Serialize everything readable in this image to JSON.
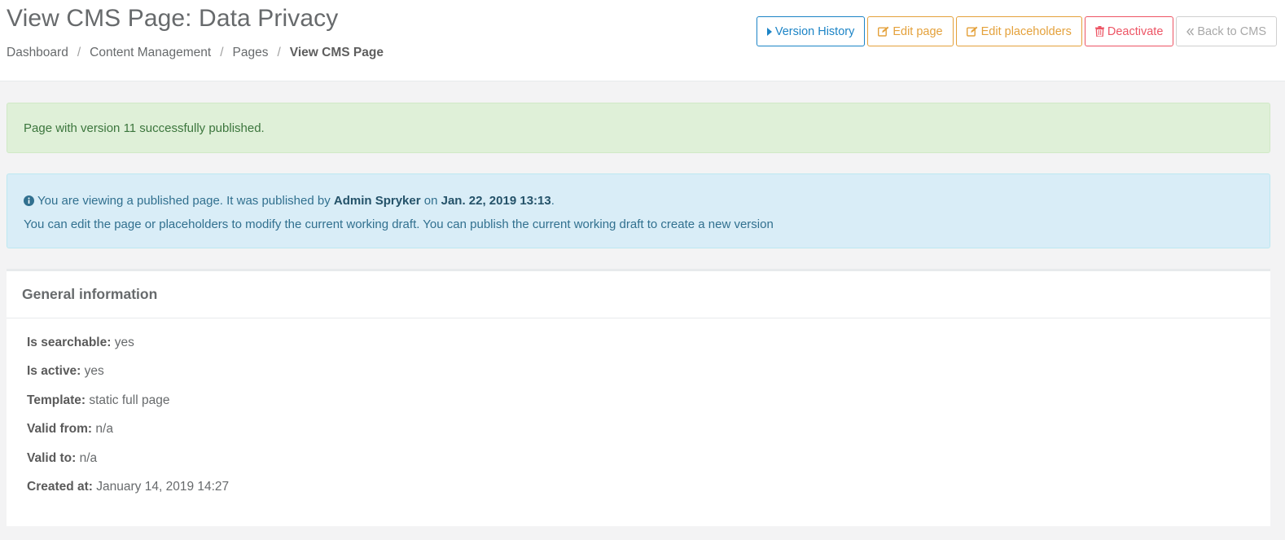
{
  "page": {
    "title": "View CMS Page: Data Privacy"
  },
  "breadcrumb": {
    "items": [
      "Dashboard",
      "Content Management",
      "Pages"
    ],
    "separator": "/",
    "active": "View CMS Page"
  },
  "toolbar": {
    "version_history": "Version History",
    "edit_page": "Edit page",
    "edit_placeholders": "Edit placeholders",
    "deactivate": "Deactivate",
    "back_to_cms": "Back to CMS"
  },
  "alerts": {
    "success": "Page with version 11 successfully published.",
    "info": {
      "prefix": "You are viewing a published page. It was published by",
      "publisher": "Admin Spryker",
      "on": "on",
      "date": "Jan. 22, 2019 13:13",
      "suffix": ".",
      "line2": "You can edit the page or placeholders to modify the current working draft. You can publish the current working draft to create a new version"
    }
  },
  "general": {
    "title": "General information",
    "fields": [
      {
        "label": "Is searchable:",
        "value": "yes"
      },
      {
        "label": "Is active:",
        "value": "yes"
      },
      {
        "label": "Template:",
        "value": "static full page"
      },
      {
        "label": "Valid from:",
        "value": "n/a"
      },
      {
        "label": "Valid to:",
        "value": "n/a"
      },
      {
        "label": "Created at:",
        "value": "January 14, 2019 14:27"
      }
    ]
  },
  "colors": {
    "blue": "#1c84c6",
    "orange": "#e4a13b",
    "red": "#ed5565",
    "success_bg": "#dff0d8",
    "info_bg": "#d9edf7"
  },
  "icons": {
    "version_history": "caret-right-icon",
    "edit_page": "edit-icon",
    "edit_placeholders": "edit-icon",
    "deactivate": "trash-icon",
    "back_to_cms": "double-chevron-left-icon",
    "info": "info-circle-icon"
  }
}
